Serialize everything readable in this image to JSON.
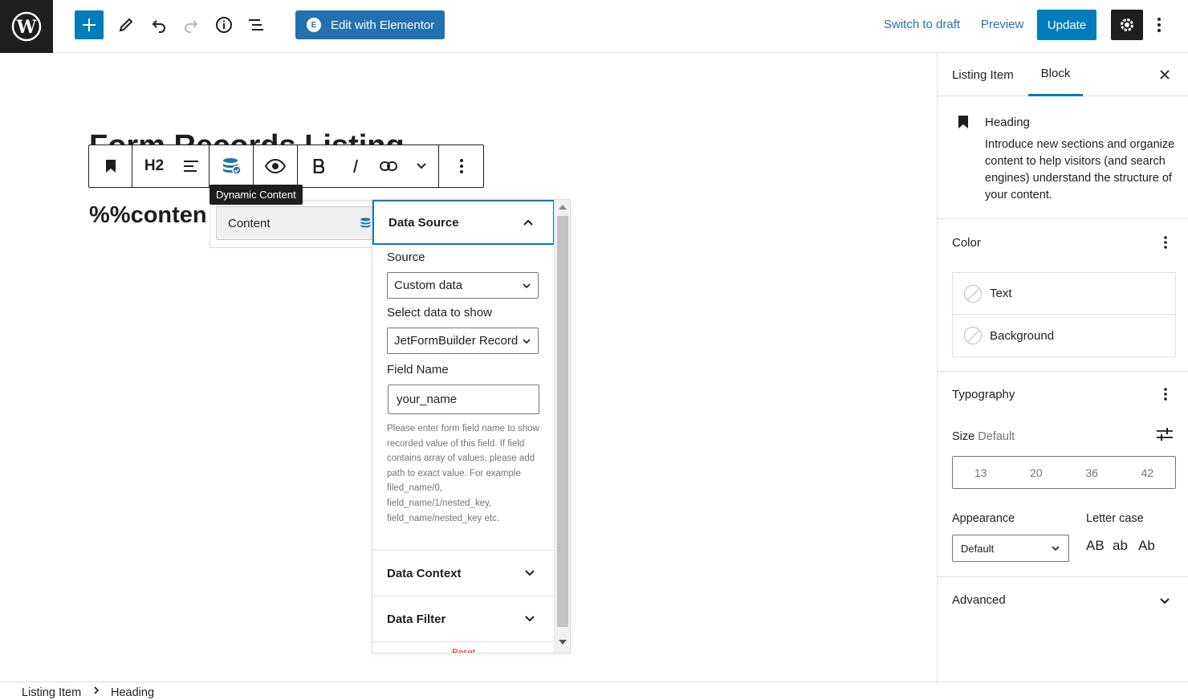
{
  "topbar": {
    "elementor_label": "Edit with Elementor",
    "switch_to_draft": "Switch to draft",
    "preview": "Preview",
    "update": "Update"
  },
  "editor": {
    "page_title": "Form Records Listing",
    "content_heading": "%%conten"
  },
  "block_toolbar": {
    "heading_level": "H2",
    "tooltip": "Dynamic Content"
  },
  "dynamic_popover": {
    "item_label": "Content"
  },
  "settings_popover": {
    "data_source": {
      "title": "Data Source",
      "source_label": "Source",
      "source_value": "Custom data",
      "select_label": "Select data to show",
      "select_value": "JetFormBuilder Record F",
      "field_label": "Field Name",
      "field_value": "your_name",
      "help": "Please enter form field name to show recorded value of this field. If field contains array of values, please add path to exact value. For example filed_name/0, field_name/1/nested_key, field_name/nested_key etc."
    },
    "data_context_title": "Data Context",
    "data_filter_title": "Data Filter",
    "reset": "Reset"
  },
  "sidebar": {
    "tab_listing": "Listing Item",
    "tab_block": "Block",
    "block_name": "Heading",
    "block_desc": "Introduce new sections and organize content to help visitors (and search engines) understand the structure of your content.",
    "color_title": "Color",
    "color_text": "Text",
    "color_background": "Background",
    "typography_title": "Typography",
    "size_label": "Size",
    "size_value": "Default",
    "sizes": [
      "13",
      "20",
      "36",
      "42"
    ],
    "appearance_label": "Appearance",
    "appearance_value": "Default",
    "letter_case_label": "Letter case",
    "case_upper": "AB",
    "case_lower": "ab",
    "case_cap": "Ab",
    "advanced_title": "Advanced"
  },
  "footer": {
    "crumb_1": "Listing Item",
    "crumb_2": "Heading"
  },
  "colors": {
    "accent": "#007cba",
    "elementor": "#2271b1",
    "dark": "#1e1e1e"
  }
}
